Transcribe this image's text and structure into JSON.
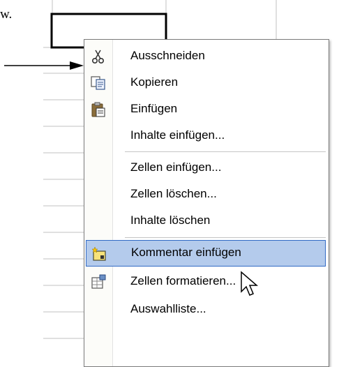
{
  "doc": {
    "text_fragment": "w."
  },
  "context_menu": {
    "items": [
      {
        "label": "Ausschneiden",
        "icon": "scissors-icon"
      },
      {
        "label": "Kopieren",
        "icon": "copy-icon"
      },
      {
        "label": "Einfügen",
        "icon": "paste-icon"
      },
      {
        "label": "Inhalte einfügen...",
        "icon": ""
      },
      {
        "label": "Zellen einfügen...",
        "icon": ""
      },
      {
        "label": "Zellen löschen...",
        "icon": ""
      },
      {
        "label": "Inhalte löschen",
        "icon": ""
      },
      {
        "label": "Kommentar einfügen",
        "icon": "insert-comment-icon",
        "highlighted": true
      },
      {
        "label": "Zellen formatieren...",
        "icon": "format-cells-icon"
      },
      {
        "label": "Auswahlliste...",
        "icon": ""
      }
    ]
  },
  "colors": {
    "highlight_fill": "#b4cbec",
    "highlight_border": "#316ac5",
    "grid_line": "#c0c0c0"
  }
}
